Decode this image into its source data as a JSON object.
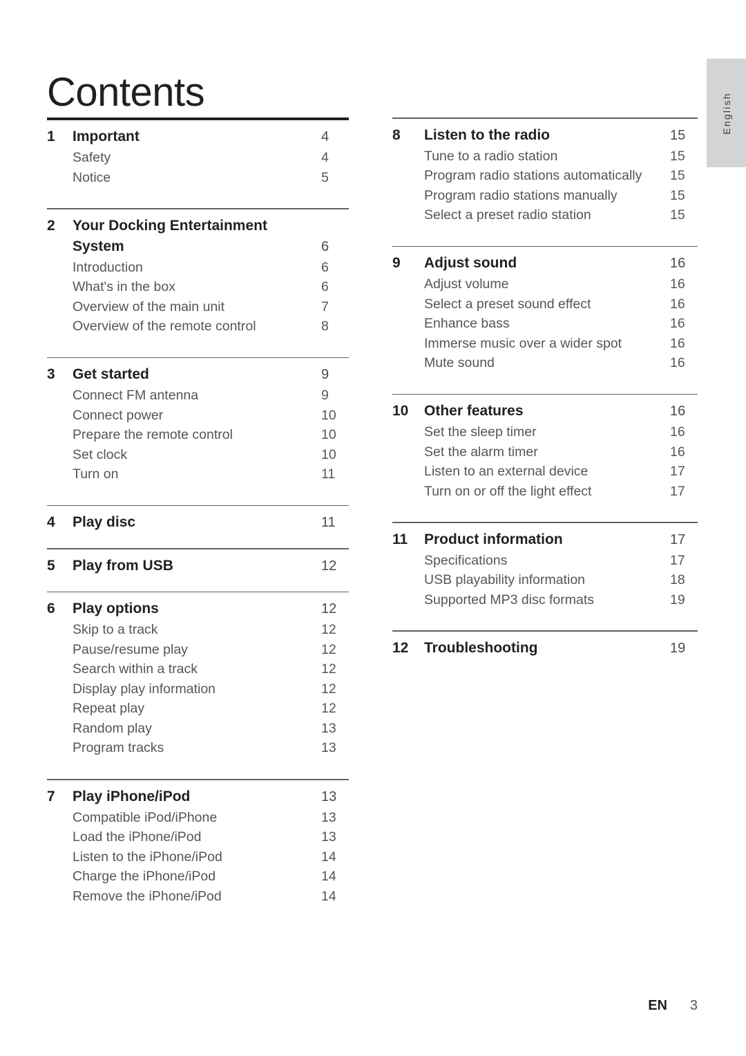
{
  "document": {
    "title": "Contents",
    "language_tab": "English",
    "footer": {
      "locale": "EN",
      "page_number": "3"
    }
  },
  "columns": {
    "left": [
      {
        "number": "1",
        "title": "Important",
        "page": "4",
        "rule": "thick",
        "items": [
          {
            "label": "Safety",
            "page": "4"
          },
          {
            "label": "Notice",
            "page": "5"
          }
        ]
      },
      {
        "number": "2",
        "title": "Your Docking Entertainment System",
        "page": "6",
        "rule": "thin",
        "wraps": true,
        "items": [
          {
            "label": "Introduction",
            "page": "6"
          },
          {
            "label": "What's in the box",
            "page": "6"
          },
          {
            "label": "Overview of the main unit",
            "page": "7"
          },
          {
            "label": "Overview of the remote control",
            "page": "8"
          }
        ]
      },
      {
        "number": "3",
        "title": "Get started",
        "page": "9",
        "rule": "thin",
        "items": [
          {
            "label": "Connect FM antenna",
            "page": "9"
          },
          {
            "label": "Connect power",
            "page": "10"
          },
          {
            "label": "Prepare the remote control",
            "page": "10"
          },
          {
            "label": "Set clock",
            "page": "10"
          },
          {
            "label": "Turn on",
            "page": "11"
          }
        ]
      },
      {
        "number": "4",
        "title": "Play disc",
        "page": "11",
        "rule": "thin",
        "items": []
      },
      {
        "number": "5",
        "title": "Play from USB",
        "page": "12",
        "rule": "thin",
        "items": []
      },
      {
        "number": "6",
        "title": "Play options",
        "page": "12",
        "rule": "thin",
        "items": [
          {
            "label": "Skip to a track",
            "page": "12"
          },
          {
            "label": "Pause/resume play",
            "page": "12"
          },
          {
            "label": "Search within a track",
            "page": "12"
          },
          {
            "label": "Display play information",
            "page": "12"
          },
          {
            "label": "Repeat play",
            "page": "12"
          },
          {
            "label": "Random play",
            "page": "13"
          },
          {
            "label": "Program tracks",
            "page": "13"
          }
        ]
      },
      {
        "number": "7",
        "title": "Play iPhone/iPod",
        "page": "13",
        "rule": "thin",
        "items": [
          {
            "label": "Compatible iPod/iPhone",
            "page": "13"
          },
          {
            "label": "Load the iPhone/iPod",
            "page": "13"
          },
          {
            "label": "Listen to the iPhone/iPod",
            "page": "14"
          },
          {
            "label": "Charge the iPhone/iPod",
            "page": "14"
          },
          {
            "label": "Remove the iPhone/iPod",
            "page": "14"
          }
        ]
      }
    ],
    "right": [
      {
        "number": "8",
        "title": "Listen to the radio",
        "page": "15",
        "rule": "thin",
        "items": [
          {
            "label": "Tune to a radio station",
            "page": "15"
          },
          {
            "label": "Program radio stations automatically",
            "page": "15"
          },
          {
            "label": "Program radio stations manually",
            "page": "15"
          },
          {
            "label": "Select a preset radio station",
            "page": "15"
          }
        ]
      },
      {
        "number": "9",
        "title": "Adjust sound",
        "page": "16",
        "rule": "thin",
        "items": [
          {
            "label": "Adjust volume",
            "page": "16"
          },
          {
            "label": "Select a preset sound effect",
            "page": "16"
          },
          {
            "label": "Enhance bass",
            "page": "16"
          },
          {
            "label": "Immerse music over a wider spot",
            "page": "16"
          },
          {
            "label": "Mute sound",
            "page": "16"
          }
        ]
      },
      {
        "number": "10",
        "title": "Other features",
        "page": "16",
        "rule": "thin",
        "items": [
          {
            "label": "Set the sleep timer",
            "page": "16"
          },
          {
            "label": "Set the alarm timer",
            "page": "16"
          },
          {
            "label": "Listen to an external device",
            "page": "17"
          },
          {
            "label": "Turn on or off the light effect",
            "page": "17"
          }
        ]
      },
      {
        "number": "11",
        "title": "Product information",
        "page": "17",
        "rule": "thin",
        "items": [
          {
            "label": "Specifications",
            "page": "17"
          },
          {
            "label": "USB playability information",
            "page": "18"
          },
          {
            "label": "Supported MP3 disc formats",
            "page": "19"
          }
        ]
      },
      {
        "number": "12",
        "title": "Troubleshooting",
        "page": "19",
        "rule": "thin",
        "items": []
      }
    ]
  }
}
